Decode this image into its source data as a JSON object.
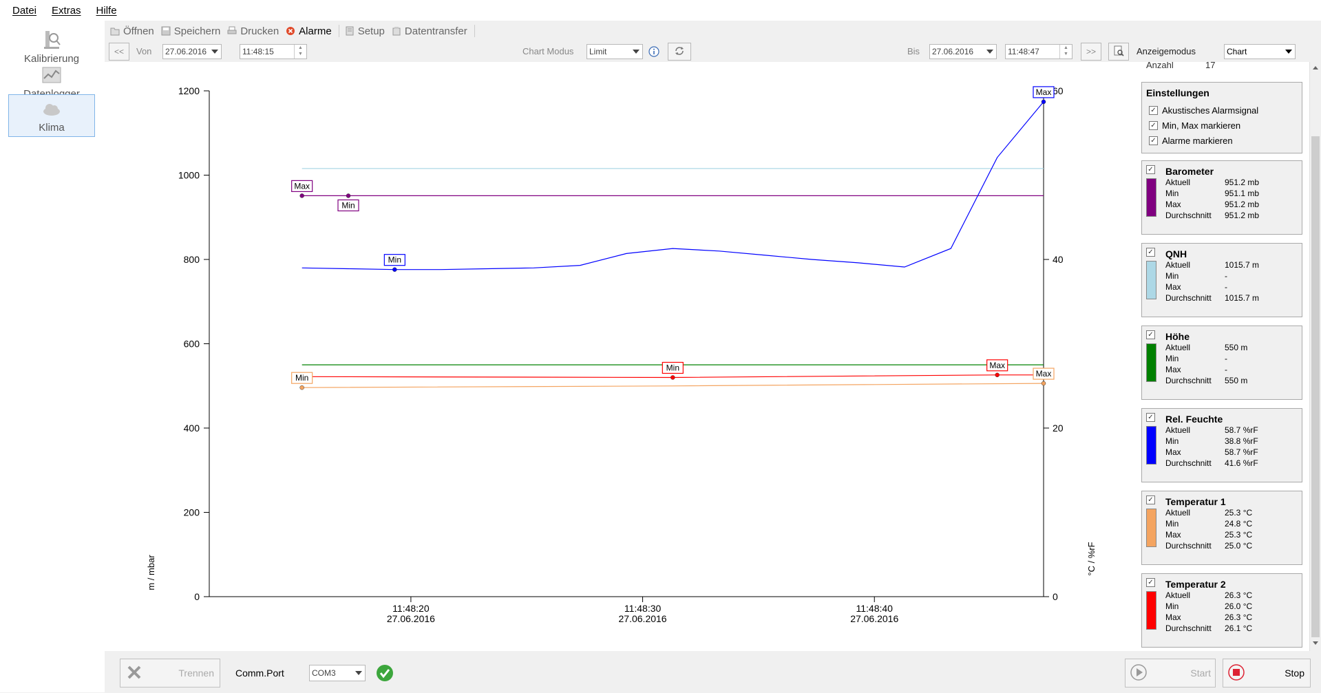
{
  "menu": {
    "items": [
      "Datei",
      "Extras",
      "Hilfe"
    ]
  },
  "nav": {
    "items": [
      {
        "label": "Kalibrierung",
        "icon": "calibration-icon",
        "active": false
      },
      {
        "label": "Datenlogger",
        "icon": "chart-icon",
        "active": false
      },
      {
        "label": "Klima",
        "icon": "cloud-icon",
        "active": true
      }
    ]
  },
  "toolbar": {
    "open": "Öffnen",
    "save": "Speichern",
    "print": "Drucken",
    "alarms": "Alarme",
    "setup": "Setup",
    "transfer": "Datentransfer"
  },
  "navrow": {
    "prev": "<<",
    "von_label": "Von",
    "von_date": "27.06.2016",
    "von_time": "11:48:15",
    "chartmodus_label": "Chart Modus",
    "chartmodus_value": "Limit",
    "bis_label": "Bis",
    "bis_date": "27.06.2016",
    "bis_time": "11:48:47",
    "next": ">>",
    "anzeigemodus_label": "Anzeigemodus",
    "anzeigemodus_value": "Chart"
  },
  "right": {
    "anzahl_label": "Anzahl",
    "anzahl_value": "17",
    "settings": {
      "title": "Einstellungen",
      "options": [
        {
          "label": "Akustisches Alarmsignal",
          "checked": true
        },
        {
          "label": "Min, Max markieren",
          "checked": true
        },
        {
          "label": "Alarme markieren",
          "checked": true
        }
      ]
    },
    "row_labels": [
      "Aktuell",
      "Min",
      "Max",
      "Durchschnitt"
    ],
    "sensors": [
      {
        "name": "Barometer",
        "color": "#800080",
        "aktuell": "951.2 mb",
        "min": "951.1 mb",
        "max": "951.2 mb",
        "avg": "951.2 mb"
      },
      {
        "name": "QNH",
        "color": "#add8e6",
        "aktuell": "1015.7 m",
        "min": "-",
        "max": "-",
        "avg": "1015.7 m"
      },
      {
        "name": "Höhe",
        "color": "#008000",
        "aktuell": "550 m",
        "min": "-",
        "max": "-",
        "avg": "550 m"
      },
      {
        "name": "Rel. Feuchte",
        "color": "#0000ff",
        "aktuell": "58.7 %rF",
        "min": "38.8 %rF",
        "max": "58.7 %rF",
        "avg": "41.6 %rF"
      },
      {
        "name": "Temperatur 1",
        "color": "#f4a460",
        "aktuell": "25.3 °C",
        "min": "24.8 °C",
        "max": "25.3 °C",
        "avg": "25.0 °C"
      },
      {
        "name": "Temperatur 2",
        "color": "#ff0000",
        "aktuell": "26.3 °C",
        "min": "26.0 °C",
        "max": "26.3 °C",
        "avg": "26.1 °C"
      }
    ]
  },
  "bottom": {
    "disconnect": "Trennen",
    "commport_label": "Comm.Port",
    "commport_value": "COM3",
    "start": "Start",
    "stop": "Stop"
  },
  "chart_data": {
    "type": "line",
    "ylabel_left": "m / mbar",
    "ylabel_right": "°C / %rF",
    "ylim_left": [
      0,
      1200
    ],
    "ylim_right": [
      0,
      60
    ],
    "yticks_left": [
      0,
      200,
      400,
      600,
      800,
      1000,
      1200
    ],
    "yticks_right": [
      0,
      20,
      40,
      60
    ],
    "xlim_seconds": [
      11.3,
      47.3
    ],
    "xticks": [
      {
        "sec": 20,
        "time": "11:48:20",
        "date": "27.06.2016"
      },
      {
        "sec": 30,
        "time": "11:48:30",
        "date": "27.06.2016"
      },
      {
        "sec": 40,
        "time": "11:48:40",
        "date": "27.06.2016"
      }
    ],
    "series": [
      {
        "name": "Barometer",
        "axis": "left",
        "color": "#800080",
        "x": [
          15.3,
          47.3
        ],
        "y": [
          951.2,
          951.2
        ]
      },
      {
        "name": "QNH",
        "axis": "left",
        "color": "#add8e6",
        "x": [
          15.3,
          47.3
        ],
        "y": [
          1015.7,
          1015.7
        ]
      },
      {
        "name": "Höhe",
        "axis": "left",
        "color": "#008000",
        "x": [
          15.3,
          47.3
        ],
        "y": [
          550,
          550
        ]
      },
      {
        "name": "Rel. Feuchte",
        "axis": "right",
        "color": "#0000ff",
        "x": [
          15.3,
          17.3,
          19.3,
          21.3,
          23.3,
          25.3,
          27.3,
          29.3,
          31.3,
          33.3,
          35.3,
          37.3,
          39.3,
          41.3,
          43.3,
          45.3,
          47.3
        ],
        "y": [
          39.0,
          38.9,
          38.8,
          38.8,
          38.9,
          39.0,
          39.3,
          40.7,
          41.3,
          41.0,
          40.5,
          40.0,
          39.6,
          39.1,
          41.3,
          52.1,
          58.7
        ]
      },
      {
        "name": "Temperatur 1",
        "axis": "right",
        "color": "#f4a460",
        "x": [
          15.3,
          31.3,
          47.3
        ],
        "y": [
          24.8,
          25.0,
          25.3
        ]
      },
      {
        "name": "Temperatur 2",
        "axis": "right",
        "color": "#ff0000",
        "x": [
          15.3,
          31.3,
          45.3,
          47.3
        ],
        "y": [
          26.1,
          26.0,
          26.3,
          26.3
        ]
      }
    ],
    "markers": [
      {
        "label": "Max",
        "x": 15.3,
        "y": 951.2,
        "axis": "left",
        "color": "#800080",
        "pos": "above"
      },
      {
        "label": "Min",
        "x": 17.3,
        "y": 951.1,
        "axis": "left",
        "color": "#800080",
        "pos": "below"
      },
      {
        "label": "Min",
        "x": 19.3,
        "y": 38.8,
        "axis": "right",
        "color": "#0000ff",
        "pos": "above"
      },
      {
        "label": "Max",
        "x": 47.3,
        "y": 58.7,
        "axis": "right",
        "color": "#0000ff",
        "pos": "above"
      },
      {
        "label": "Min",
        "x": 15.3,
        "y": 24.8,
        "axis": "right",
        "color": "#f4a460",
        "pos": "above"
      },
      {
        "label": "Max",
        "x": 47.3,
        "y": 25.3,
        "axis": "right",
        "color": "#f4a460",
        "pos": "above"
      },
      {
        "label": "Min",
        "x": 31.3,
        "y": 26.0,
        "axis": "right",
        "color": "#ff0000",
        "pos": "above"
      },
      {
        "label": "Max",
        "x": 45.3,
        "y": 26.3,
        "axis": "right",
        "color": "#ff0000",
        "pos": "above"
      }
    ],
    "grid": false,
    "legend": "right-panel"
  }
}
